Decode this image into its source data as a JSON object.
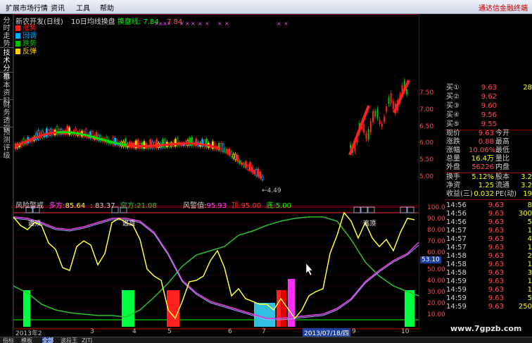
{
  "menu": {
    "items": [
      "扩展市场行情",
      "资讯",
      "工具",
      "帮助"
    ],
    "brand": "通达信金融终端"
  },
  "sidebar": {
    "tabs": [
      "分时走势",
      "技术分析",
      "基本资料",
      "财务透视",
      "预测评级"
    ]
  },
  "chart_header": {
    "stock": "新农开发(日线)",
    "ma_label": "10日均线换盘",
    "ma_name": "换盘线:",
    "ma_value": "7.84",
    "ma_value2": "7.84"
  },
  "legend": [
    {
      "label": "涨势",
      "color": "#ff2020"
    },
    {
      "label": "回调",
      "color": "#00b0ff"
    },
    {
      "label": "跌势",
      "color": "#00c000"
    },
    {
      "label": "反弹",
      "color": "#ffd000"
    }
  ],
  "price_axis": [
    "7.50",
    "7.00",
    "6.50",
    "6.00",
    "5.50",
    "5.00"
  ],
  "ma_note": "←4.49",
  "indicator": {
    "name": "风险警戒",
    "duo_label": "多方:",
    "duo_value": "85.64",
    "duo_value2": ": 83.37",
    "kong_label": "空方:",
    "kong_value": "21.08",
    "risk_label": "风警值:",
    "risk_value": "95.93",
    "top_label": "顶:",
    "top_value": "95.00",
    "bottom_label": "底:",
    "bottom_value": "5.00",
    "top_markers": [
      "逃顶",
      "逃顶",
      "逃顶"
    ],
    "axis": [
      "100.0",
      "90.00",
      "80.00",
      "70.00",
      "60.00",
      "50.00",
      "40.00",
      "30.00",
      "20.00",
      "10.00"
    ],
    "cursor_value": "53.10"
  },
  "date_axis": {
    "labels": [
      "2013年2",
      "3",
      "4",
      "5",
      "6",
      "7",
      "8",
      "9",
      "10"
    ],
    "selected": "2013/07/18/四"
  },
  "bottom_tabs": [
    "指标",
    "模板",
    "全部",
    "波段王",
    "ZJTJ"
  ],
  "quote": {
    "buy": [
      {
        "label": "买①",
        "price": "9.63",
        "vol": "28"
      },
      {
        "label": "买②",
        "price": "9.62",
        "vol": ""
      },
      {
        "label": "买③",
        "price": "9.60",
        "vol": ""
      },
      {
        "label": "买④",
        "price": "9.56",
        "vol": ""
      },
      {
        "label": "买⑤",
        "price": "9.55",
        "vol": ""
      }
    ],
    "info": [
      {
        "l": "现价",
        "v": "9.63",
        "l2": "今开",
        "v2": ""
      },
      {
        "l": "涨跌",
        "v": "0.88",
        "l2": "最高",
        "v2": ""
      },
      {
        "l": "涨幅",
        "v": "10.06%",
        "l2": "最低",
        "v2": ""
      },
      {
        "l": "总量",
        "v": "16.4万",
        "l2": "量比",
        "v2": ""
      },
      {
        "l": "外盘",
        "v": "56226",
        "l2": "内盘",
        "v2": ""
      }
    ],
    "info2": [
      {
        "l": "换手",
        "v": "5.12%",
        "l2": "股本",
        "v2": "3.2"
      },
      {
        "l": "净资",
        "v": "1.25",
        "l2": "流通",
        "v2": "3.2"
      },
      {
        "l": "收益(三)",
        "v": "0.032",
        "l2": "PE(动)",
        "v2": "19"
      }
    ],
    "ticks": [
      {
        "t": "14:56",
        "p": "9.63",
        "vol": "8"
      },
      {
        "t": "14:56",
        "p": "9.63",
        "vol": "300"
      },
      {
        "t": "14:56",
        "p": "9.63",
        "vol": "5"
      },
      {
        "t": "14:57",
        "p": "9.63",
        "vol": "1"
      },
      {
        "t": "14:57",
        "p": "9.63",
        "vol": "4"
      },
      {
        "t": "14:57",
        "p": "9.63",
        "vol": "1"
      },
      {
        "t": "14:58",
        "p": "9.63",
        "vol": "2"
      },
      {
        "t": "14:58",
        "p": "9.63",
        "vol": "1"
      },
      {
        "t": "14:58",
        "p": "9.63",
        "vol": "3"
      },
      {
        "t": "14:59",
        "p": "9.63",
        "vol": "1"
      },
      {
        "t": "14:59",
        "p": "9.63",
        "vol": "1"
      },
      {
        "t": "14:59",
        "p": "9.63",
        "vol": "5"
      },
      {
        "t": "14:59",
        "p": "9.63",
        "vol": "250"
      }
    ]
  },
  "watermark": "www.7gpzb.com"
}
